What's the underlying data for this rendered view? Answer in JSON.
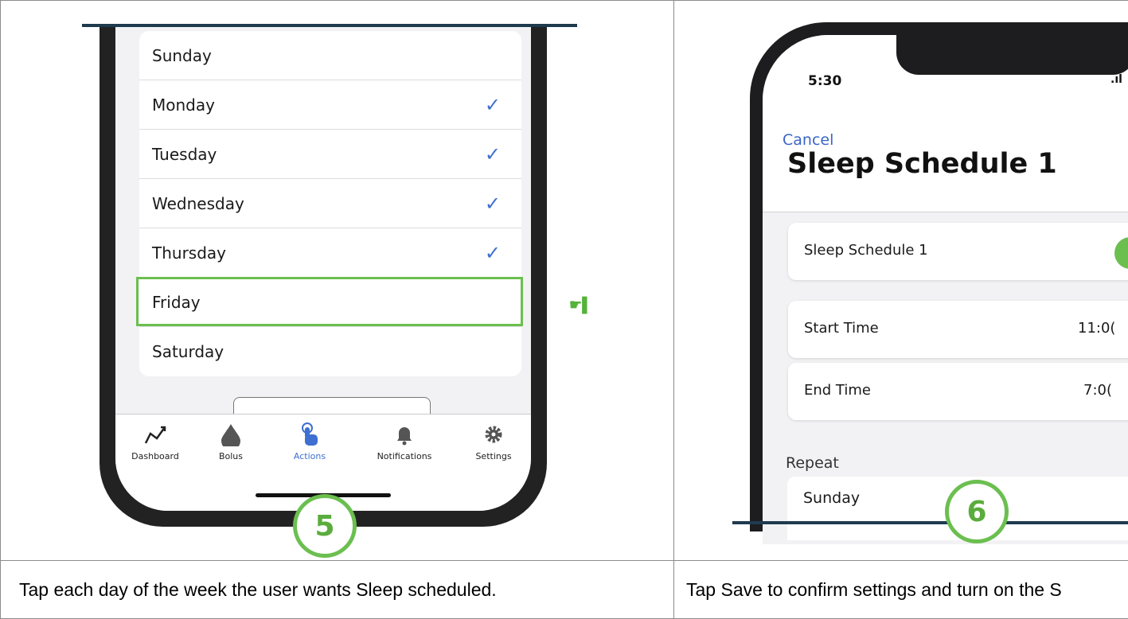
{
  "step5": {
    "number": "5",
    "days": [
      {
        "label": "Sunday",
        "checked": false
      },
      {
        "label": "Monday",
        "checked": true
      },
      {
        "label": "Tuesday",
        "checked": true
      },
      {
        "label": "Wednesday",
        "checked": true
      },
      {
        "label": "Thursday",
        "checked": true
      },
      {
        "label": "Friday",
        "checked": false
      },
      {
        "label": "Saturday",
        "checked": false
      }
    ],
    "highlighted_day": "Friday",
    "check_symbol": "✓",
    "tabs": [
      {
        "label": "Dashboard",
        "icon": "graph-icon"
      },
      {
        "label": "Bolus",
        "icon": "drop-icon"
      },
      {
        "label": "Actions",
        "icon": "tap-hand-icon",
        "active": true
      },
      {
        "label": "Notifications",
        "icon": "bell-icon"
      },
      {
        "label": "Settings",
        "icon": "gear-icon"
      }
    ],
    "caption": "Tap each day of the week the user wants Sleep scheduled."
  },
  "step6": {
    "number": "6",
    "status_time": "5:30",
    "signal": ".ıl",
    "cancel_label": "Cancel",
    "title": "Sleep Schedule 1",
    "schedule_label": "Sleep Schedule 1",
    "schedule_enabled": true,
    "start_label": "Start Time",
    "start_value": "11:0(",
    "end_label": "End Time",
    "end_value": "7:0(",
    "repeat_label": "Repeat",
    "first_day": "Sunday",
    "caption": "Tap Save to confirm settings and turn on the S"
  },
  "colors": {
    "accent_green": "#6bbf4f",
    "check_blue": "#3e6fd1",
    "link_blue": "#3a66c6",
    "frame_dark": "#222222"
  }
}
